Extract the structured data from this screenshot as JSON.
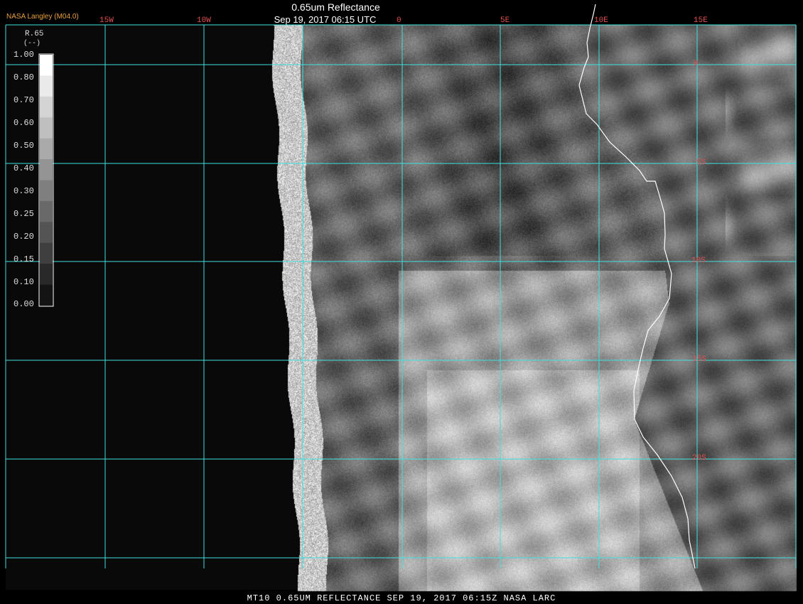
{
  "credit": "NASA Langley (M04.0)",
  "title": "0.65um Reflectance",
  "subtitle": "Sep 19, 2017 06:15 UTC",
  "footer": "MT10  0.65UM REFLECTANCE   SEP 19, 2017 06:15Z   NASA LARC",
  "lon_labels": [
    "15W",
    "10W",
    "0",
    "5E",
    "10E",
    "15E"
  ],
  "lat_labels": [
    "0",
    "5S",
    "10S",
    "15S",
    "20S"
  ],
  "legend": {
    "title": "R.65",
    "unit": "(--)",
    "levels": [
      "1.00",
      "0.80",
      "0.70",
      "0.60",
      "0.50",
      "0.40",
      "0.30",
      "0.25",
      "0.20",
      "0.15",
      "0.10",
      "0.00"
    ]
  },
  "colors": {
    "grid": "#40e0e0",
    "grid_label": "#e05050",
    "coast": "#ffffff",
    "credit": "#e8a040"
  }
}
